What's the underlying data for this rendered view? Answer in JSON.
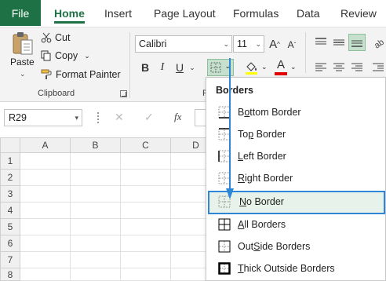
{
  "tabs": {
    "file": "File",
    "home": "Home",
    "insert": "Insert",
    "page_layout": "Page Layout",
    "formulas": "Formulas",
    "data": "Data",
    "review": "Review"
  },
  "clipboard": {
    "paste": "Paste",
    "cut": "Cut",
    "copy": "Copy",
    "format_painter": "Format Painter",
    "group_label": "Clipboard"
  },
  "font": {
    "name": "Calibri",
    "size": "11",
    "bold": "B",
    "italic": "I",
    "underline": "U",
    "font_color_letter": "A",
    "group_label_partial": "F"
  },
  "formula_bar": {
    "name_box": "R29",
    "cancel": "✕",
    "enter": "✓",
    "fx": "fx"
  },
  "grid": {
    "columns": [
      "A",
      "B",
      "C",
      "D"
    ],
    "rows": [
      "1",
      "2",
      "3",
      "4",
      "5",
      "6",
      "7",
      "8"
    ]
  },
  "borders_menu": {
    "title": "Borders",
    "items": [
      {
        "accel": "o",
        "pre": "B",
        "post": "ttom Border"
      },
      {
        "accel": "p",
        "pre": "To",
        "post": " Border"
      },
      {
        "accel": "L",
        "pre": "",
        "post": "eft Border"
      },
      {
        "accel": "R",
        "pre": "",
        "post": "ight Border"
      },
      {
        "accel": "N",
        "pre": "",
        "post": "o Border"
      },
      {
        "accel": "A",
        "pre": "",
        "post": "ll Borders"
      },
      {
        "accel": "S",
        "pre": "Out",
        "post": "ide Borders"
      },
      {
        "accel": "T",
        "pre": "",
        "post": "hick Outside Borders"
      }
    ],
    "highlighted_index": 4
  },
  "colors": {
    "excel_green": "#1e7145",
    "highlight_fill": "#e6f2ea",
    "highlight_border": "#2e86d6",
    "arrow": "#2e86d6",
    "font_color_bar": "#e00000"
  }
}
